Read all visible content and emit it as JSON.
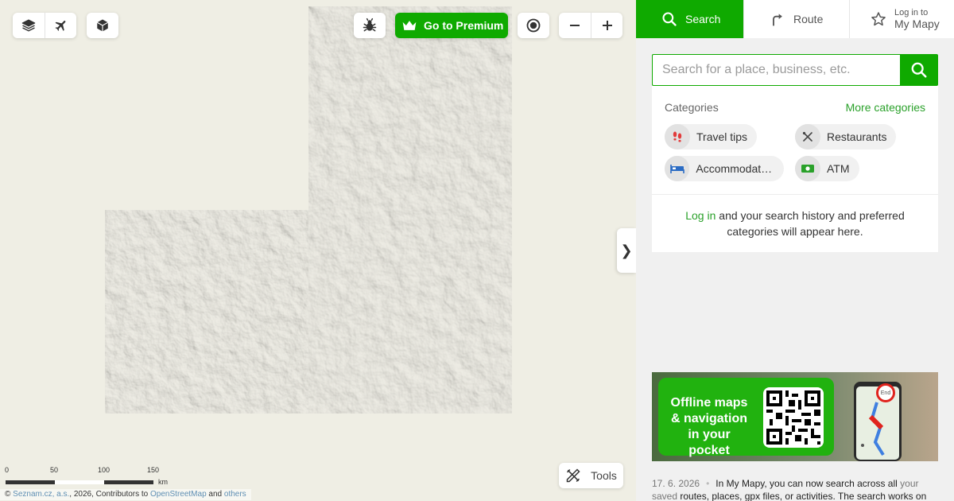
{
  "map": {
    "controls": {
      "layers_icon": "layers-icon",
      "plane_icon": "airplane-icon",
      "cube_icon": "cube-3d-icon",
      "bug_icon": "bug-icon",
      "premium_label": "Go to Premium",
      "locate_icon": "target-icon",
      "zoom_out_icon": "minus-icon",
      "zoom_in_icon": "plus-icon",
      "tools_label": "Tools",
      "collapse_glyph": "❯"
    },
    "scale": {
      "ticks": [
        "0",
        "50",
        "100",
        "150"
      ],
      "unit": "km"
    },
    "attribution": {
      "prefix": "© ",
      "seznam": "Seznam.cz, a.s.",
      "middle": ", 2026, Contributors to ",
      "osm": "OpenStreetMap",
      "and": " and ",
      "others": "others"
    }
  },
  "panel": {
    "tabs": {
      "search": "Search",
      "route": "Route",
      "mymapy_small": "Log in to",
      "mymapy_big": "My Mapy"
    },
    "search": {
      "placeholder": "Search for a place, business, etc."
    },
    "categories": {
      "heading": "Categories",
      "more": "More categories",
      "items": [
        {
          "label": "Travel tips",
          "icon": "footprints-icon"
        },
        {
          "label": "Restaurants",
          "icon": "cutlery-icon"
        },
        {
          "label": "Accommodation",
          "icon": "bed-icon"
        },
        {
          "label": "ATM",
          "icon": "banknote-icon"
        }
      ]
    },
    "history": {
      "login": "Log in",
      "rest": " and your search history and preferred categories will appear here."
    },
    "promo": {
      "text": "Offline maps & navigation in your pocket",
      "pin": "End"
    },
    "news": {
      "date": "17. 6. 2026",
      "dot": "•",
      "p1": "In My Mapy, you can now search across all ",
      "p2": "your saved",
      "p3": " routes, places, gpx files, or activities. The search works on"
    }
  },
  "colors": {
    "brand_green": "#0faa00",
    "link_green": "#2aa12a",
    "map_bg": "#efeee4"
  }
}
